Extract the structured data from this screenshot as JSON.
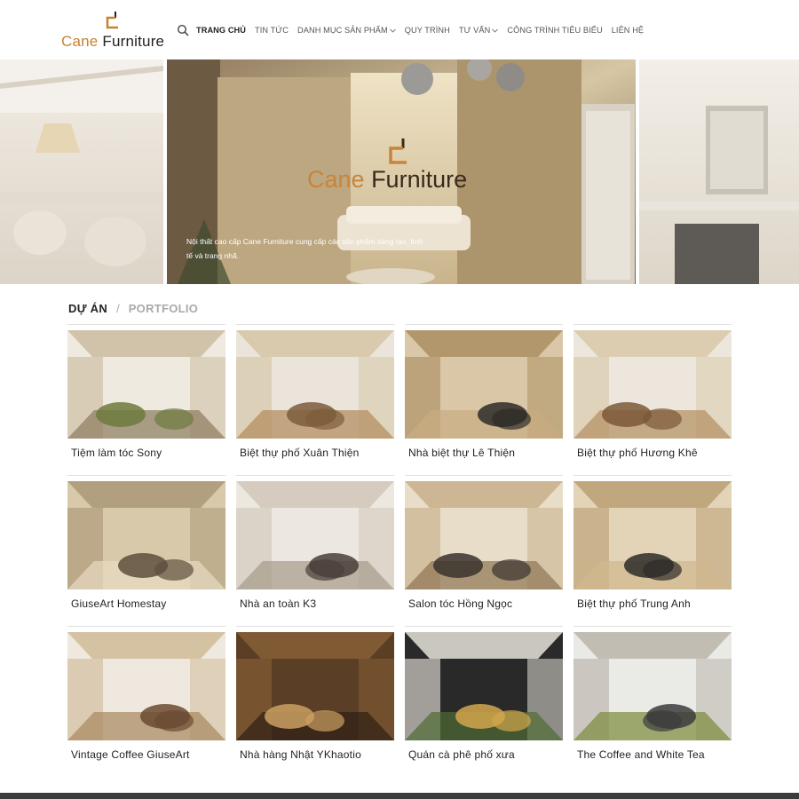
{
  "brand": {
    "word1": "Cane",
    "word2": "Furniture"
  },
  "nav": {
    "items": [
      {
        "label": "TRANG CHỦ",
        "active": true,
        "dropdown": false
      },
      {
        "label": "TIN TỨC",
        "active": false,
        "dropdown": false
      },
      {
        "label": "DANH MỤC SẢN PHẨM",
        "active": false,
        "dropdown": true
      },
      {
        "label": "QUY TRÌNH",
        "active": false,
        "dropdown": false
      },
      {
        "label": "TƯ VẤN",
        "active": false,
        "dropdown": true
      },
      {
        "label": "CÔNG TRÌNH TIÊU BIỂU",
        "active": false,
        "dropdown": false
      },
      {
        "label": "LIÊN HỆ",
        "active": false,
        "dropdown": false
      }
    ],
    "search_icon": "search-icon"
  },
  "hero": {
    "logo_word1": "Cane",
    "logo_word2": "Furniture",
    "caption": "Nội thất cao cấp Cane Furniture cung cấp các sản phẩm sáng tạo, tinh tế và trang nhã."
  },
  "section": {
    "title": "DỰ ÁN",
    "separator": "/",
    "subtitle": "PORTFOLIO"
  },
  "projects": [
    {
      "title": "Tiệm làm tóc Sony"
    },
    {
      "title": "Biệt thự phố Xuân Thiện"
    },
    {
      "title": "Nhà biệt thự Lê Thiện"
    },
    {
      "title": "Biệt thự phố Hương Khê"
    },
    {
      "title": "GiuseArt Homestay"
    },
    {
      "title": "Nhà an toàn K3"
    },
    {
      "title": "Salon tóc Hồng Ngọc"
    },
    {
      "title": "Biệt thự phố Trung Anh"
    },
    {
      "title": "Vintage Coffee GiuseArt"
    },
    {
      "title": "Nhà hàng Nhật YKhaotio"
    },
    {
      "title": "Quán cà phê phố xưa"
    },
    {
      "title": "The Coffee and White Tea"
    }
  ],
  "colors": {
    "brand_orange": "#c8822f",
    "text_dark": "#222222",
    "text_muted": "#aaaaaa",
    "footer": "#3c3c3c"
  }
}
